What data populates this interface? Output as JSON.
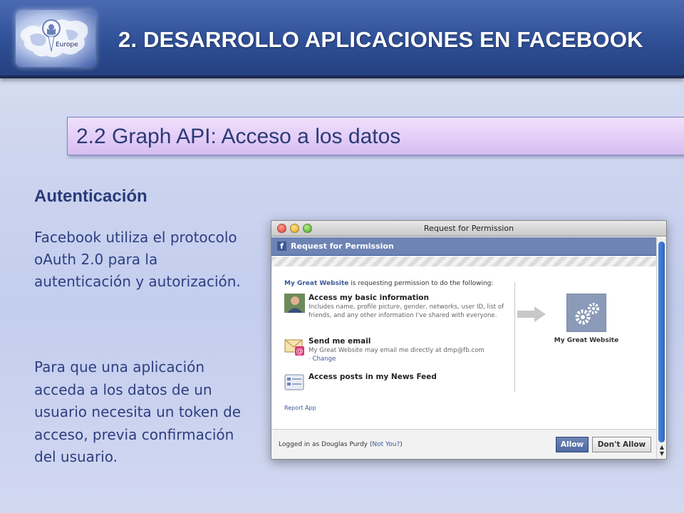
{
  "header": {
    "title": "2. DESARROLLO APLICACIONES EN FACEBOOK",
    "logo_label": "Europe"
  },
  "subtitle": "2.2 Graph API: Acceso a los datos",
  "section": {
    "heading": "Autenticación",
    "para1": "Facebook utiliza el protocolo oAuth 2.0 para la autenticación y autorización.",
    "para2": "Para que una aplicación acceda a los datos de un usuario necesita un token de acceso, previa confirmación del usuario."
  },
  "dialog": {
    "window_title": "Request for Permission",
    "fb_bar_title": "Request for Permission",
    "request_site": "My Great Website",
    "request_text": " is requesting permission to do the following:",
    "permissions": [
      {
        "title": "Access my basic information",
        "desc": "Includes name, profile picture, gender, networks, user ID, list of friends, and any other information I've shared with everyone.",
        "icon": "user-avatar-icon"
      },
      {
        "title": "Send me email",
        "desc": "My Great Website may email me directly at dmp@fb.com",
        "change": "· Change",
        "icon": "email-icon"
      },
      {
        "title": "Access posts in my News Feed",
        "desc": "",
        "icon": "news-feed-icon"
      }
    ],
    "report_link": "Report App",
    "app_name": "My Great Website",
    "footer": {
      "logged_prefix": "Logged in as Douglas Purdy (",
      "not_you": "Not You?",
      "logged_suffix": ")",
      "allow": "Allow",
      "dont_allow": "Don't Allow"
    }
  },
  "colors": {
    "header_bg": "#2f4f96",
    "subtitle_bg": "#e4cff8",
    "text_blue": "#2e3f80",
    "fb_blue": "#3b5998"
  }
}
